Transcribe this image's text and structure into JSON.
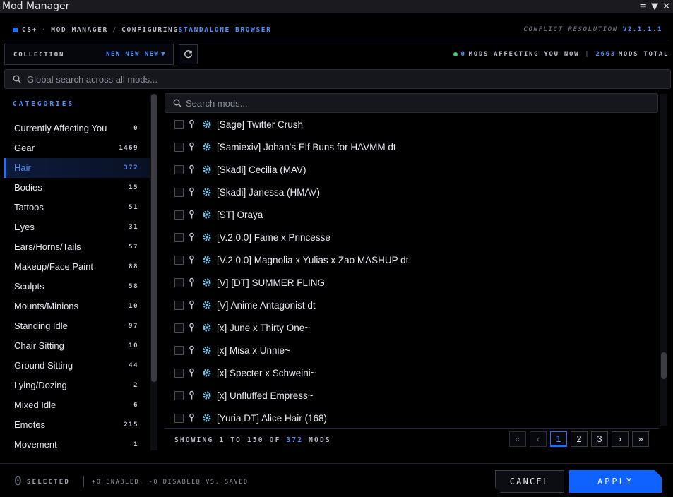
{
  "window": {
    "title": "Mod Manager",
    "controls": [
      "≡",
      "▼",
      "✕"
    ]
  },
  "header": {
    "brand": "CS+",
    "section": "MOD MANAGER",
    "separator": "/",
    "configuring_label": "CONFIGURING",
    "configuring_target": "STANDALONE BROWSER",
    "version_label": "CONFLICT RESOLUTION",
    "version": "V2.1.1.1"
  },
  "collection": {
    "label": "COLLECTION",
    "value": "NEW NEW NEW"
  },
  "stats": {
    "affecting_count": "0",
    "affecting_label": "MODS AFFECTING YOU NOW",
    "total_count": "2663",
    "total_label": "MODS TOTAL"
  },
  "global_search": {
    "placeholder": "Global search across all mods..."
  },
  "categories": {
    "heading": "CATEGORIES",
    "items": [
      {
        "label": "Currently Affecting You",
        "count": "0"
      },
      {
        "label": "Gear",
        "count": "1469"
      },
      {
        "label": "Hair",
        "count": "372",
        "active": true
      },
      {
        "label": "Bodies",
        "count": "15"
      },
      {
        "label": "Tattoos",
        "count": "51"
      },
      {
        "label": "Eyes",
        "count": "31"
      },
      {
        "label": "Ears/Horns/Tails",
        "count": "57"
      },
      {
        "label": "Makeup/Face Paint",
        "count": "88"
      },
      {
        "label": "Sculpts",
        "count": "58"
      },
      {
        "label": "Mounts/Minions",
        "count": "10"
      },
      {
        "label": "Standing Idle",
        "count": "97"
      },
      {
        "label": "Chair Sitting",
        "count": "10"
      },
      {
        "label": "Ground Sitting",
        "count": "44"
      },
      {
        "label": "Lying/Dozing",
        "count": "2"
      },
      {
        "label": "Mixed Idle",
        "count": "6"
      },
      {
        "label": "Emotes",
        "count": "215"
      },
      {
        "label": "Movement",
        "count": "1"
      }
    ]
  },
  "mod_search": {
    "placeholder": "Search mods..."
  },
  "mods": [
    "[Sage] Twitter Crush",
    "[Samiexiv] Johan's Elf Buns for HAVMM dt",
    "[Skadi] Cecilia (MAV)",
    "[Skadi] Janessa (HMAV)",
    "[ST] Oraya",
    "[V.2.0.0] Fame x Princesse",
    "[V.2.0.0] Magnolia x Yulias x Zao MASHUP dt",
    "[V] [DT] SUMMER FLING",
    "[V] Anime Antagonist dt",
    "[x] June x Thirty One~",
    "[x] Misa x Unnie~",
    "[x] Specter x Schweini~",
    "[x] Unfluffed Empress~",
    "[Yuria DT] Alice Hair (168)"
  ],
  "listing": {
    "showing_label": "SHOWING",
    "from": "1",
    "to_label": "TO",
    "to": "150",
    "of_label": "OF",
    "total": "372",
    "unit": "MODS"
  },
  "pagination": {
    "first": "«",
    "prev": "‹",
    "pages": [
      "1",
      "2",
      "3"
    ],
    "current": "1",
    "next": "›",
    "last": "»"
  },
  "footer": {
    "selected_count": "0",
    "selected_label": "SELECTED",
    "changes": "+0 ENABLED, -0 DISABLED VS. SAVED",
    "cancel_label": "CANCEL",
    "apply_label": "APPLY"
  },
  "colors": {
    "accent": "#4f8fff",
    "primary_button": "#0f62ff",
    "status_dot": "#3fd17a",
    "gear_icon": "#6fc7e6"
  }
}
